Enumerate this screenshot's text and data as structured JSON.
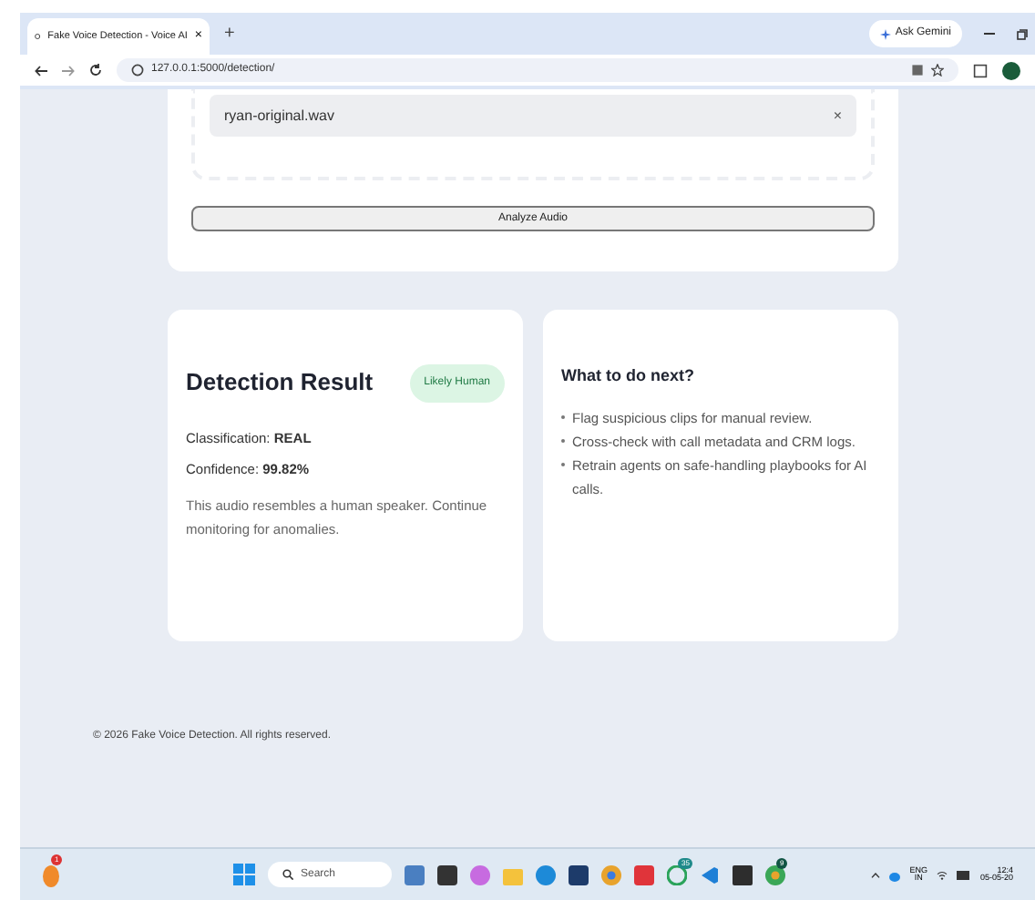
{
  "browser": {
    "tab_title": "Fake Voice Detection - Voice AI",
    "new_tab": "+",
    "ask_gemini": "Ask Gemini",
    "url": "127.0.0.1:5000/detection/"
  },
  "upload": {
    "file_name": "ryan-original.wav",
    "remove": "×",
    "button": "Analyze Audio"
  },
  "result": {
    "title": "Detection Result",
    "badge": "Likely Human",
    "classification": "Classification: **REAL**",
    "confidence": "Confidence: **99.82%**",
    "note": "This audio resembles a human speaker. Continue monitoring for anomalies."
  },
  "next_steps": {
    "title": "What to do next?",
    "items": [
      "Flag suspicious clips for manual review.",
      "Cross-check with call metadata and CRM logs.",
      "Retrain agents on safe-handling playbooks for AI calls."
    ]
  },
  "footer": "© 2026 Fake Voice Detection. All rights reserved.",
  "taskbar": {
    "search": "Search",
    "badges": [
      "1",
      "35",
      "9"
    ],
    "language": "ENG",
    "region": "IN",
    "time": "12:4",
    "date": "05-05-20"
  }
}
